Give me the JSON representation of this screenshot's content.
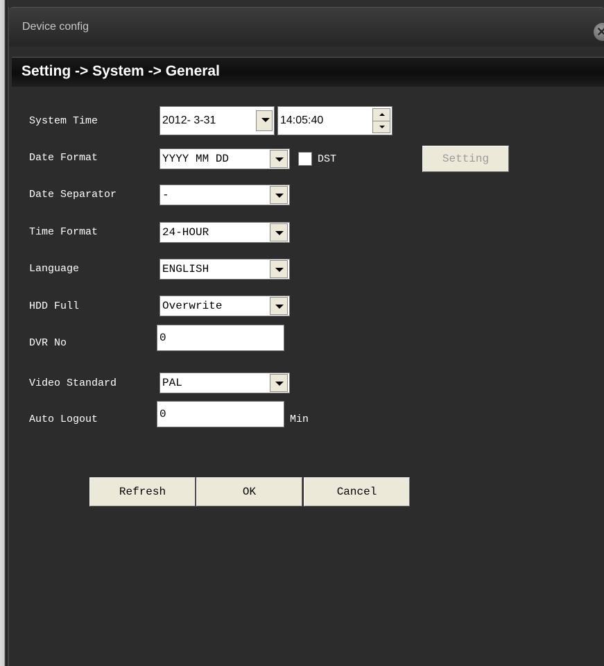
{
  "window": {
    "title": "Device config"
  },
  "breadcrumb": "Setting -> System -> General",
  "fields": {
    "system_time": {
      "label": "System Time",
      "date": "2012- 3-31",
      "time": "14:05:40"
    },
    "date_format": {
      "label": "Date Format",
      "value": "YYYY MM DD"
    },
    "dst": {
      "label": "DST",
      "checked": false
    },
    "dst_setting_button": "Setting",
    "date_separator": {
      "label": "Date Separator",
      "value": "-"
    },
    "time_format": {
      "label": "Time Format",
      "value": "24-HOUR"
    },
    "language": {
      "label": "Language",
      "value": "ENGLISH"
    },
    "hdd_full": {
      "label": "HDD Full",
      "value": "Overwrite"
    },
    "dvr_no": {
      "label": "DVR No",
      "value": "0"
    },
    "video_standard": {
      "label": "Video Standard",
      "value": "PAL"
    },
    "auto_logout": {
      "label": "Auto Logout",
      "value": "0",
      "unit": "Min"
    }
  },
  "buttons": {
    "refresh": "Refresh",
    "ok": "OK",
    "cancel": "Cancel"
  },
  "icons": {
    "close": "close-icon",
    "dropdown": "chevron-down-icon",
    "spinner": "spinner-arrows-icon"
  }
}
